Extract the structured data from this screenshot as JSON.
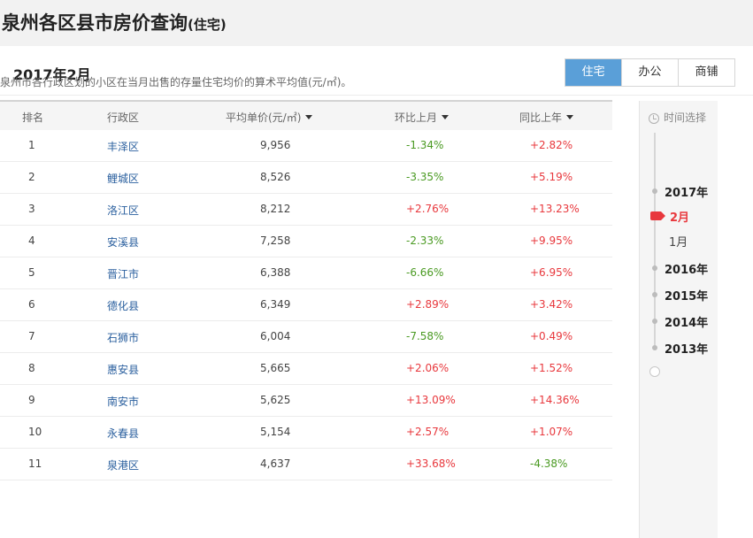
{
  "page": {
    "title": "泉州各区县市房价查询",
    "title_suffix": "(住宅)"
  },
  "header": {
    "period": "2017年2月",
    "tabs": [
      {
        "label": "住宅",
        "active": true
      },
      {
        "label": "办公",
        "active": false
      },
      {
        "label": "商铺",
        "active": false
      }
    ]
  },
  "description": "泉州市各行政区划的小区在当月出售的存量住宅均价的算术平均值(元/㎡)。",
  "table": {
    "columns": [
      "排名",
      "行政区",
      "平均单价(元/㎡)",
      "环比上月",
      "同比上年"
    ],
    "rows": [
      {
        "rank": "1",
        "district": "丰泽区",
        "price": "9,956",
        "mom": "-1.34%",
        "yoy": "+2.82%"
      },
      {
        "rank": "2",
        "district": "鲤城区",
        "price": "8,526",
        "mom": "-3.35%",
        "yoy": "+5.19%"
      },
      {
        "rank": "3",
        "district": "洛江区",
        "price": "8,212",
        "mom": "+2.76%",
        "yoy": "+13.23%"
      },
      {
        "rank": "4",
        "district": "安溪县",
        "price": "7,258",
        "mom": "-2.33%",
        "yoy": "+9.95%"
      },
      {
        "rank": "5",
        "district": "晋江市",
        "price": "6,388",
        "mom": "-6.66%",
        "yoy": "+6.95%"
      },
      {
        "rank": "6",
        "district": "德化县",
        "price": "6,349",
        "mom": "+2.89%",
        "yoy": "+3.42%"
      },
      {
        "rank": "7",
        "district": "石狮市",
        "price": "6,004",
        "mom": "-7.58%",
        "yoy": "+0.49%"
      },
      {
        "rank": "8",
        "district": "惠安县",
        "price": "5,665",
        "mom": "+2.06%",
        "yoy": "+1.52%"
      },
      {
        "rank": "9",
        "district": "南安市",
        "price": "5,625",
        "mom": "+13.09%",
        "yoy": "+14.36%"
      },
      {
        "rank": "10",
        "district": "永春县",
        "price": "5,154",
        "mom": "+2.57%",
        "yoy": "+1.07%"
      },
      {
        "rank": "11",
        "district": "泉港区",
        "price": "4,637",
        "mom": "+33.68%",
        "yoy": "-4.38%"
      }
    ]
  },
  "timeline": {
    "heading": "时间选择",
    "years": [
      "2017年",
      "2016年",
      "2015年",
      "2014年",
      "2013年"
    ],
    "months_2017": [
      "2月",
      "1月"
    ],
    "selected_month": "2月"
  },
  "colors": {
    "up": "#e8383d",
    "down": "#4a9a22",
    "active_tab": "#5a9fd8",
    "link": "#2a5f9e"
  }
}
